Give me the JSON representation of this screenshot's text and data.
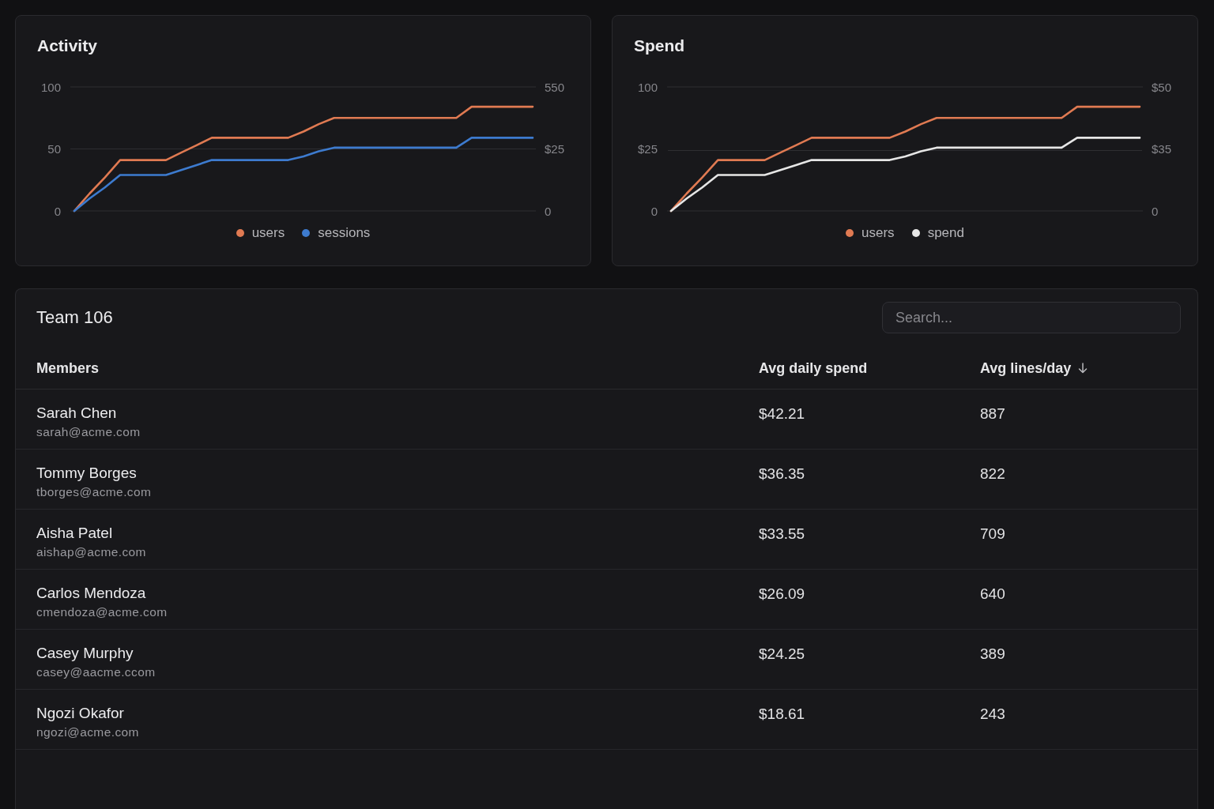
{
  "charts": [
    {
      "chart_data": {
        "type": "line",
        "title": "Activity",
        "categories": [
          null,
          null,
          null,
          null,
          null,
          null,
          null,
          null,
          null,
          null,
          null,
          null,
          null,
          null,
          null,
          null,
          null,
          null,
          null,
          null,
          null,
          null,
          null,
          null,
          null,
          null,
          null,
          null,
          null,
          null,
          null
        ],
        "ylim": [
          0,
          100
        ],
        "yticks": [
          {
            "value": 0,
            "label": "0"
          },
          {
            "value": 50,
            "label": "50"
          },
          {
            "value": 100,
            "label": "100"
          }
        ],
        "series": [
          {
            "name": "users",
            "color": "#e07a52",
            "values": [
              0,
              14,
              27,
              41,
              41,
              41,
              41,
              47,
              53,
              59,
              59,
              59,
              59,
              59,
              59,
              64,
              70,
              75,
              75,
              75,
              75,
              75,
              75,
              75,
              75,
              75,
              84,
              84,
              84,
              84,
              84
            ]
          },
          {
            "name": "sessions",
            "color": "#3d7bcf",
            "values": [
              0,
              10,
              19,
              29,
              29,
              29,
              29,
              33,
              37,
              41,
              41,
              41,
              41,
              41,
              41,
              44,
              48,
              51,
              51,
              51,
              51,
              51,
              51,
              51,
              51,
              51,
              59,
              59,
              59,
              59,
              59
            ]
          }
        ],
        "legend": "bottom"
      },
      "right_axis_labels": [
        "550",
        "$25",
        "0"
      ]
    },
    {
      "chart_data": {
        "type": "line",
        "title": "Spend",
        "categories": [
          null,
          null,
          null,
          null,
          null,
          null,
          null,
          null,
          null,
          null,
          null,
          null,
          null,
          null,
          null,
          null,
          null,
          null,
          null,
          null,
          null,
          null,
          null,
          null,
          null,
          null,
          null,
          null,
          null,
          null,
          null
        ],
        "ylim": [
          0,
          100
        ],
        "yticks": [
          {
            "value": 0,
            "label": "0"
          },
          {
            "value": 100,
            "label": "100"
          }
        ],
        "series": [
          {
            "name": "users",
            "color": "#e07a52",
            "values": [
              0,
              14,
              27,
              41,
              41,
              41,
              41,
              47,
              53,
              59,
              59,
              59,
              59,
              59,
              59,
              64,
              70,
              75,
              75,
              75,
              75,
              75,
              75,
              75,
              75,
              75,
              84,
              84,
              84,
              84,
              84
            ]
          },
          {
            "name": "spend",
            "color": "#e6e6e6",
            "values": [
              0,
              10,
              19,
              29,
              29,
              29,
              29,
              33,
              37,
              41,
              41,
              41,
              41,
              41,
              41,
              44,
              48,
              51,
              51,
              51,
              51,
              51,
              51,
              51,
              51,
              51,
              59,
              59,
              59,
              59,
              59
            ]
          }
        ],
        "legend": "bottom"
      },
      "left_axis_middle_label": "$25",
      "right_axis_labels": [
        "$50",
        "$35",
        "0"
      ]
    }
  ],
  "team": {
    "title": "Team 106",
    "search": {
      "placeholder": "Search..."
    },
    "table": {
      "columns": [
        {
          "label": "Members",
          "sorted": false
        },
        {
          "label": "Avg daily spend",
          "sorted": false
        },
        {
          "label": "Avg lines/day",
          "sorted": true
        }
      ],
      "rows": [
        {
          "name": "Sarah Chen",
          "email": "sarah@acme.com",
          "avg_daily_spend": "$42.21",
          "avg_lines_day": "887"
        },
        {
          "name": "Tommy Borges",
          "email": "tborges@acme.com",
          "avg_daily_spend": "$36.35",
          "avg_lines_day": "822"
        },
        {
          "name": "Aisha Patel",
          "email": "aishap@acme.com",
          "avg_daily_spend": "$33.55",
          "avg_lines_day": "709"
        },
        {
          "name": "Carlos Mendoza",
          "email": "cmendoza@acme.com",
          "avg_daily_spend": "$26.09",
          "avg_lines_day": "640"
        },
        {
          "name": "Casey Murphy",
          "email": "casey@aacme.ccom",
          "avg_daily_spend": "$24.25",
          "avg_lines_day": "389"
        },
        {
          "name": "Ngozi Okafor",
          "email": "ngozi@acme.com",
          "avg_daily_spend": "$18.61",
          "avg_lines_day": "243"
        }
      ]
    }
  }
}
